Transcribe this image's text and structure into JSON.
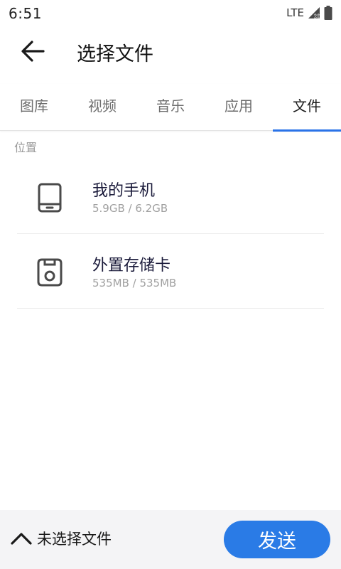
{
  "status_bar": {
    "time": "6:51",
    "network": "LTE",
    "signal_icon": "signal-no-data-icon",
    "battery_icon": "battery-icon"
  },
  "app_bar": {
    "back_icon": "arrow-left-icon",
    "title": "选择文件"
  },
  "tabs": [
    {
      "label": "图库",
      "active": false
    },
    {
      "label": "视频",
      "active": false
    },
    {
      "label": "音乐",
      "active": false
    },
    {
      "label": "应用",
      "active": false
    },
    {
      "label": "文件",
      "active": true
    }
  ],
  "locations": {
    "section_label": "位置",
    "items": [
      {
        "name": "我的手机",
        "size": "5.9GB / 6.2GB",
        "icon": "phone-icon"
      },
      {
        "name": "外置存储卡",
        "size": "535MB / 535MB",
        "icon": "sd-card-icon"
      }
    ]
  },
  "bottom_bar": {
    "toggle_icon": "chevron-up-icon",
    "selection_label": "未选择文件",
    "send_label": "发送"
  },
  "colors": {
    "accent": "#2a7be6",
    "tab_indicator": "#2a73e8",
    "bottom_bar_bg": "#f4f4f6"
  }
}
